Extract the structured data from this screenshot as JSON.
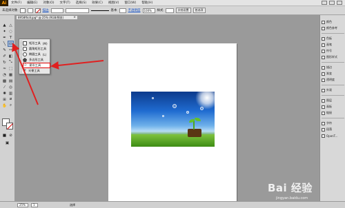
{
  "app": {
    "logo": "Ai"
  },
  "menu": {
    "items": [
      "文件(F)",
      "编辑(E)",
      "对象(O)",
      "文字(T)",
      "选择(S)",
      "效果(C)",
      "视图(V)",
      "窗口(W)",
      "帮助(H)"
    ]
  },
  "control": {
    "selection_label": "未选择对象",
    "stroke_label": "描边",
    "stroke_value": "",
    "profile_label": "基本",
    "opacity_label": "不透明度",
    "opacity_value": "100%",
    "style_label": "样式",
    "doc_setup": "文档设置",
    "preferences": "首选项"
  },
  "document_tab": {
    "title": "8958f6c8.jpg* @ 25% (RGB/预览)",
    "close": "×"
  },
  "flyout": {
    "items": [
      {
        "label": "矩形工具",
        "shortcut": "(M)"
      },
      {
        "label": "圆角矩形工具",
        "shortcut": ""
      },
      {
        "label": "椭圆工具",
        "shortcut": "(L)"
      },
      {
        "label": "多边形工具",
        "shortcut": ""
      },
      {
        "label": "星形工具",
        "shortcut": ""
      },
      {
        "label": "光晕工具",
        "shortcut": ""
      }
    ],
    "highlighted_index": 4
  },
  "right_panel": {
    "items": [
      "颜色",
      "颜色参考",
      "色板",
      "画笔",
      "符号",
      "图形样式",
      "描边",
      "渐变",
      "透明度",
      "外观",
      "图层",
      "画板",
      "链接",
      "字符",
      "段落",
      "OpenT..."
    ]
  },
  "status": {
    "zoom": "25%",
    "page": "1",
    "tool_name": "选择"
  },
  "watermark": {
    "brand": "Bai 经验",
    "url": "jingyan.baidu.com"
  },
  "colors": {
    "arrow": "#e02020",
    "highlight": "#d00000"
  }
}
